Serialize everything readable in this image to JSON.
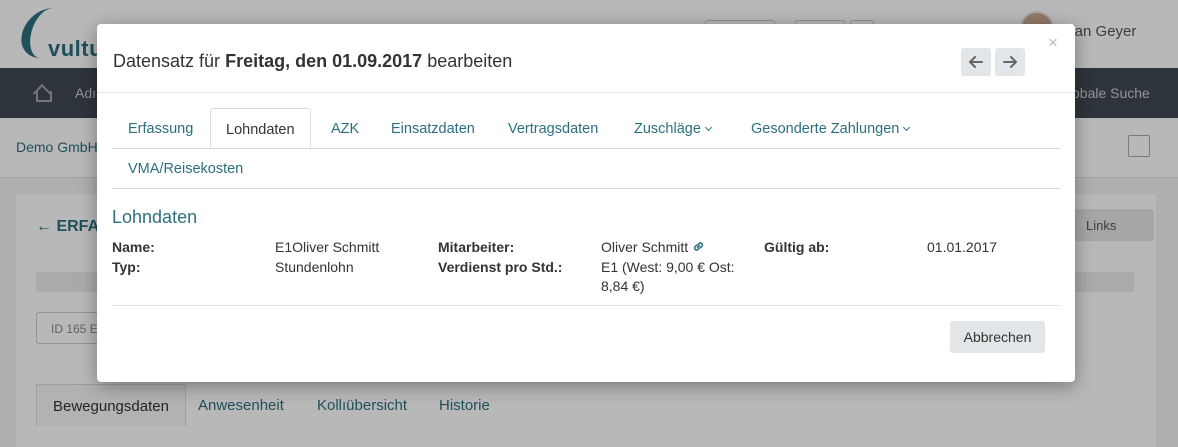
{
  "background": {
    "logo_text": "vultu",
    "user_name": "tefan Geyer",
    "nav_items": [
      "Adı",
      "obale Suche"
    ],
    "company": "Demo GmbH",
    "panel_title": "ERFA",
    "links_label": "Links",
    "id_label": "ID 165 E",
    "tabs": [
      "Bewegungsdaten",
      "Anwesenheit",
      "Kollıübersicht",
      "Historie"
    ]
  },
  "modal": {
    "title_prefix": "Datensatz für",
    "title_bold": "Freitag, den 01.09.2017",
    "title_suffix": "bearbeiten",
    "close_symbol": "×",
    "tabs": [
      {
        "label": "Erfassung",
        "active": false
      },
      {
        "label": "Lohndaten",
        "active": true
      },
      {
        "label": "AZK",
        "active": false
      },
      {
        "label": "Einsatzdaten",
        "active": false
      },
      {
        "label": "Vertragsdaten",
        "active": false
      },
      {
        "label": "Zuschläge",
        "active": false,
        "dropdown": true
      },
      {
        "label": "Gesonderte Zahlungen",
        "active": false,
        "dropdown": true
      },
      {
        "label": "VMA/Reisekosten",
        "active": false
      }
    ],
    "section_title": "Lohndaten",
    "fields": {
      "name_label": "Name:",
      "name_value": "E1Oliver Schmitt",
      "typ_label": "Typ:",
      "typ_value": "Stundenlohn",
      "mitarbeiter_label": "Mitarbeiter:",
      "mitarbeiter_value": "Oliver Schmitt",
      "verdienst_label": "Verdienst pro Std.:",
      "verdienst_value": "E1 (West: 9,00 € Ost: 8,84 €)",
      "gueltig_label": "Gültig ab:",
      "gueltig_value": "01.01.2017"
    },
    "cancel_label": "Abbrechen"
  },
  "colors": {
    "accent": "#2b6f7f",
    "button_bg": "#e3e6e8",
    "nav_bg": "#3f4952"
  },
  "icons": [
    "arrow-left-icon",
    "arrow-right-icon",
    "close-icon",
    "link-icon",
    "chevron-down-icon",
    "home-icon"
  ]
}
